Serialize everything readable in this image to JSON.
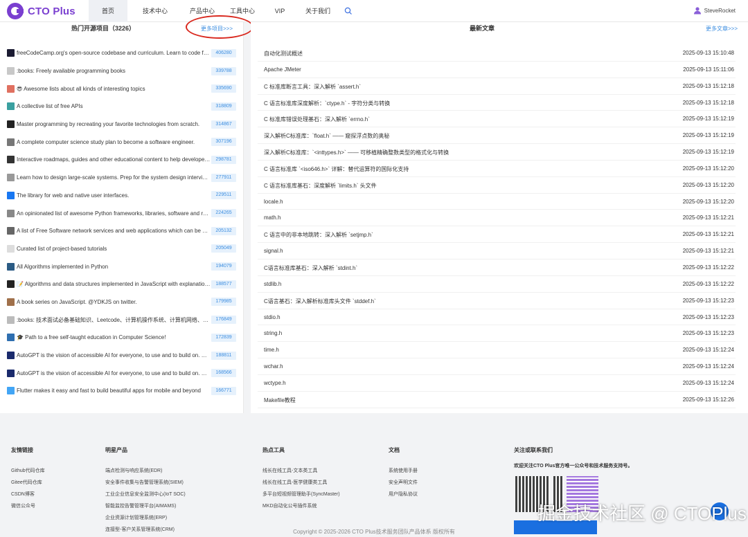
{
  "header": {
    "logo_text": "CTO Plus",
    "nav": [
      {
        "label": "首页",
        "active": true
      },
      {
        "label": "技术中心"
      },
      {
        "label": "产品中心"
      },
      {
        "label": "工具中心"
      },
      {
        "label": "VIP"
      },
      {
        "label": "关于我们"
      }
    ],
    "user_name": "SteveRocket"
  },
  "left": {
    "title": "热门开源项目（3226）",
    "more": "更多项目>>>",
    "projects": [
      {
        "desc": "freeCodeCamp.org's open-source codebase and curriculum. Learn to code for free.",
        "count": "406280",
        "icon_color": "#1b1b32"
      },
      {
        "desc": ":books: Freely available programming books",
        "count": "339788",
        "icon_color": "#c8c8c8"
      },
      {
        "desc": "😎 Awesome lists about all kinds of interesting topics",
        "count": "335690",
        "icon_color": "#e07060"
      },
      {
        "desc": "A collective list of free APIs",
        "count": "318809",
        "icon_color": "#3aa0a0"
      },
      {
        "desc": "Master programming by recreating your favorite technologies from scratch.",
        "count": "314867",
        "icon_color": "#222222"
      },
      {
        "desc": "A complete computer science study plan to become a software engineer.",
        "count": "307196",
        "icon_color": "#777777"
      },
      {
        "desc": "Interactive roadmaps, guides and other educational content to help developers grow in their careers.",
        "count": "298781",
        "icon_color": "#333333"
      },
      {
        "desc": "Learn how to design large-scale systems. Prep for the system design interview.",
        "count": "277911",
        "icon_color": "#999999"
      },
      {
        "desc": "The library for web and native user interfaces.",
        "count": "229511",
        "icon_color": "#1877f2"
      },
      {
        "desc": "An opinionated list of awesome Python frameworks, libraries, software and resources.",
        "count": "224265",
        "icon_color": "#888888"
      },
      {
        "desc": "A list of Free Software network services and web applications which can be hosted on your own servers",
        "count": "205132",
        "icon_color": "#666666"
      },
      {
        "desc": "Curated list of project-based tutorials",
        "count": "205049",
        "icon_color": "#dddddd"
      },
      {
        "desc": "All Algorithms implemented in Python",
        "count": "194079",
        "icon_color": "#2b5b84"
      },
      {
        "desc": "📝 Algorithms and data structures implemented in JavaScript with explanations and links to further readings",
        "count": "188577",
        "icon_color": "#222222"
      },
      {
        "desc": "A book series on JavaScript. @YDKJS on twitter.",
        "count": "179985",
        "icon_color": "#a0704a"
      },
      {
        "desc": ":books: 技术面试必备基础知识、Leetcode、计算机操作系统、计算机网络、系统设计",
        "count": "176849",
        "icon_color": "#bbbbbb"
      },
      {
        "desc": "🎓 Path to a free self-taught education in Computer Science!",
        "count": "172839",
        "icon_color": "#2f6fb0"
      },
      {
        "desc": "AutoGPT is the vision of accessible AI for everyone, to use and to build on. Our mission is to provide the tools",
        "count": "188811",
        "icon_color": "#1a2a6c"
      },
      {
        "desc": "AutoGPT is the vision of accessible AI for everyone, to use and to build on. Our mission is to provide the tools",
        "count": "168566",
        "icon_color": "#1a2a6c"
      },
      {
        "desc": "Flutter makes it easy and fast to build beautiful apps for mobile and beyond",
        "count": "166771",
        "icon_color": "#42a5f5"
      }
    ]
  },
  "right": {
    "title": "最新文章",
    "more": "更多文章>>>",
    "articles": [
      {
        "title": "自动化测试概述",
        "time": "2025-09-13 15:10:48"
      },
      {
        "title": "Apache JMeter",
        "time": "2025-09-13 15:11:06"
      },
      {
        "title": "C 标准库断言工具：深入解析 `assert.h`",
        "time": "2025-09-13 15:12:18"
      },
      {
        "title": "C 语言标准库深度解析：`ctype.h` - 字符分类与转换",
        "time": "2025-09-13 15:12:18"
      },
      {
        "title": "C 标准库错误处理基石：深入解析 `errno.h`",
        "time": "2025-09-13 15:12:19"
      },
      {
        "title": "深入解析C标准库：`float.h` —— 窥探浮点数的奥秘",
        "time": "2025-09-13 15:12:19"
      },
      {
        "title": "深入解析C标准库：`<inttypes.h>` —— 可移植精确整数类型的格式化与转换",
        "time": "2025-09-13 15:12:19"
      },
      {
        "title": "C 语言标准库 `<iso646.h>` 详解：替代运算符的国际化支持",
        "time": "2025-09-13 15:12:20"
      },
      {
        "title": "C 语言标准库基石：深度解析 `limits.h` 头文件",
        "time": "2025-09-13 15:12:20"
      },
      {
        "title": "locale.h",
        "time": "2025-09-13 15:12:20"
      },
      {
        "title": "math.h",
        "time": "2025-09-13 15:12:21"
      },
      {
        "title": "C 语言中的非本地跳转：深入解析 `setjmp.h`",
        "time": "2025-09-13 15:12:21"
      },
      {
        "title": "signal.h",
        "time": "2025-09-13 15:12:21"
      },
      {
        "title": "C语言标准库基石：深入解析 `stdint.h`",
        "time": "2025-09-13 15:12:22"
      },
      {
        "title": "stdlib.h",
        "time": "2025-09-13 15:12:22"
      },
      {
        "title": "C语言基石：深入解析标准库头文件 `stddef.h`",
        "time": "2025-09-13 15:12:23"
      },
      {
        "title": "stdio.h",
        "time": "2025-09-13 15:12:23"
      },
      {
        "title": "string.h",
        "time": "2025-09-13 15:12:23"
      },
      {
        "title": "time.h",
        "time": "2025-09-13 15:12:24"
      },
      {
        "title": "wchar.h",
        "time": "2025-09-13 15:12:24"
      },
      {
        "title": "wctype.h",
        "time": "2025-09-13 15:12:24"
      },
      {
        "title": "Makefile教程",
        "time": "2025-09-13 15:12:26"
      }
    ]
  },
  "footer": {
    "links": {
      "title": "友情链接",
      "items": [
        "Github代码仓库",
        "Gitee代码仓库",
        "CSDN博客",
        "微信公众号"
      ]
    },
    "products": {
      "title": "明星产品",
      "items": [
        "端点检测与响应系统(EDR)",
        "安全事件收集与告警管理系统(SIEM)",
        "工业企业信息安全监测中心(IoT SOC)",
        "智能监控告警管理平台(AIMAMS)",
        "企业资源计划管理系统(ERP)",
        "连接型-客户关系管理系统(CRM)"
      ]
    },
    "tools": {
      "title": "热点工具",
      "items": [
        "线长在线工具-文本类工具",
        "线长在线工具-医学健康类工具",
        "多平台短视频管理助手(SyncMaster)",
        "MKD自动化公号插件系统"
      ]
    },
    "docs": {
      "title": "文档",
      "items": [
        "系统使用手册",
        "安全声明文件",
        "用户隐私协议"
      ]
    },
    "follow": {
      "title": "关注或联系我们",
      "text": "欢迎关注CTO Plus官方唯一公众号和技术服务支持号。"
    },
    "copyright": "Copyright © 2025-2026 CTO Plus技术服务团队产品体系 版权所有",
    "watermark": "掘金技术社区 @ CTOPlus"
  }
}
